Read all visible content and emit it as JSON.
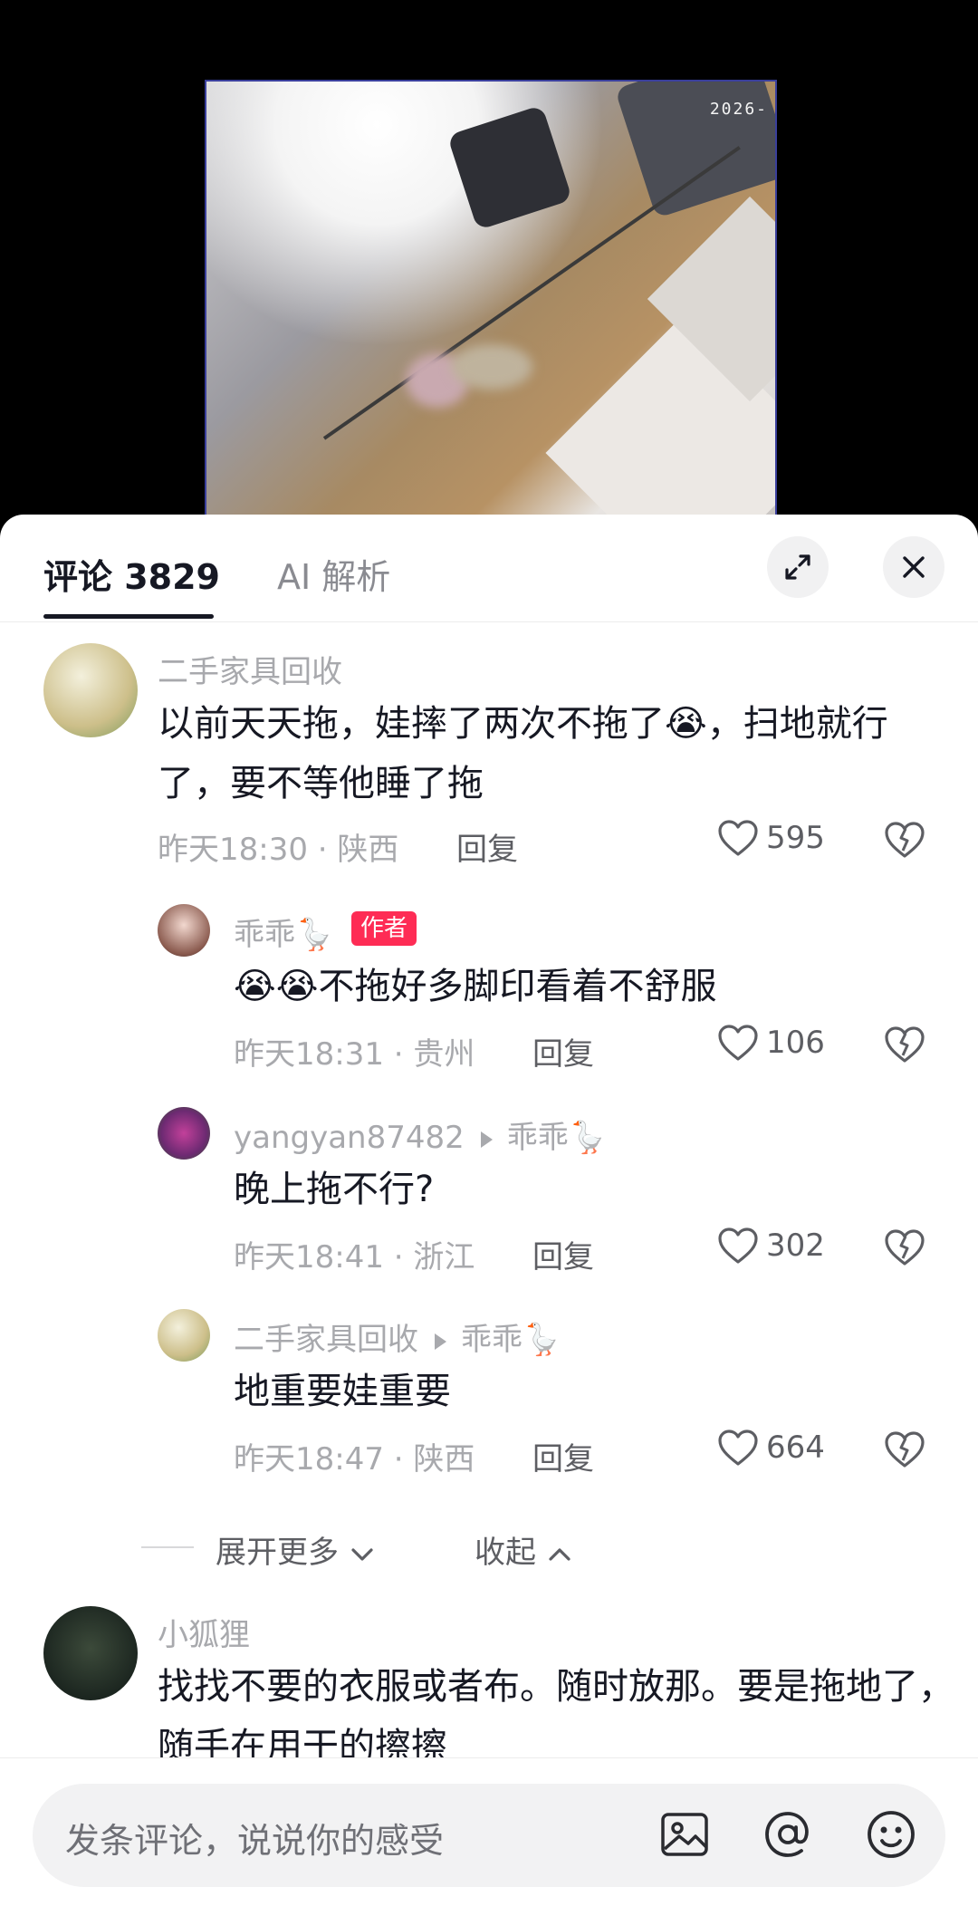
{
  "video": {
    "timestamp": "2026-"
  },
  "tabs": {
    "comments": "评论 3829",
    "ai": "AI 解析"
  },
  "comments": [
    {
      "user": "二手家具回收",
      "text": "以前天天拖，娃摔了两次不拖了😭，扫地就行了，要不等他睡了拖",
      "time": "昨天18:30 · 陕西",
      "reply": "回复",
      "likes": "595"
    },
    {
      "user": "乖乖🪿",
      "badge": "作者",
      "text": "😭😭不拖好多脚印看着不舒服",
      "time": "昨天18:31 · 贵州",
      "reply": "回复",
      "likes": "106"
    },
    {
      "user": "yangyan87482",
      "to": "乖乖🪿",
      "text": "晚上拖不行?",
      "time": "昨天18:41 · 浙江",
      "reply": "回复",
      "likes": "302"
    },
    {
      "user": "二手家具回收",
      "to": "乖乖🪿",
      "text": "地重要娃重要",
      "time": "昨天18:47 · 陕西",
      "reply": "回复",
      "likes": "664"
    },
    {
      "user": "小狐狸",
      "text": "找找不要的衣服或者布。随时放那。要是拖地了，随手在用干的擦擦"
    }
  ],
  "thread": {
    "expand_more": "展开更多",
    "collapse": "收起"
  },
  "input": {
    "placeholder": "发条评论，说说你的感受"
  },
  "colors": {
    "accent": "#fe2c55",
    "text": "#161823",
    "muted": "#a8a9ad"
  },
  "icons": [
    "expand-icon",
    "close-icon",
    "heart-icon",
    "dislike-heart-icon",
    "image-icon",
    "at-icon",
    "emoji-icon"
  ]
}
